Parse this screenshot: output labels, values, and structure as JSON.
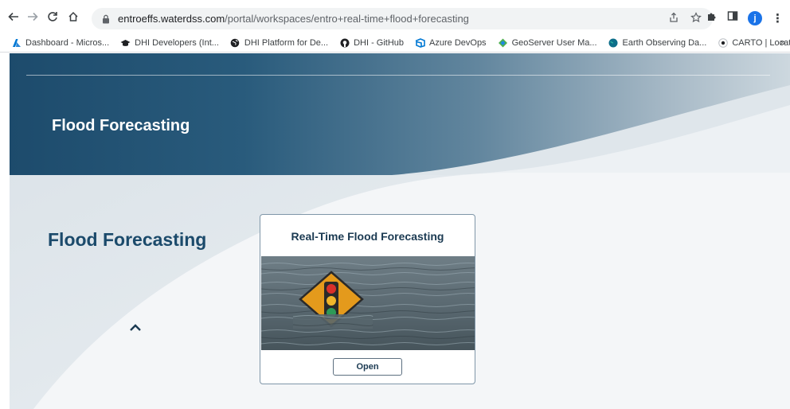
{
  "browser": {
    "url_host": "entroeffs.waterdss.com",
    "url_path": "/portal/workspaces/entro+real-time+flood+forecasting",
    "profile_initial": "j"
  },
  "bookmarks": {
    "items": [
      {
        "label": "Dashboard - Micros...",
        "icon": "azure-devops-dashboard-icon"
      },
      {
        "label": "DHI Developers (Int...",
        "icon": "graduation-cap-icon"
      },
      {
        "label": "DHI Platform for De...",
        "icon": "globe-icon"
      },
      {
        "label": "DHI - GitHub",
        "icon": "github-icon"
      },
      {
        "label": "Azure DevOps",
        "icon": "azure-devops-icon"
      },
      {
        "label": "GeoServer User Ma...",
        "icon": "geoserver-icon"
      },
      {
        "label": "Earth Observing Da...",
        "icon": "earth-icon"
      },
      {
        "label": "CARTO | Location In...",
        "icon": "carto-icon"
      }
    ],
    "more": "»"
  },
  "hero": {
    "title": "Flood Forecasting"
  },
  "section": {
    "title": "Flood Forecasting"
  },
  "card": {
    "title": "Real-Time Flood Forecasting",
    "image": "flooded-traffic-sign-image",
    "button_label": "Open"
  },
  "colors": {
    "hero_dark": "#1e4e6e",
    "title_navy": "#1b4a6b",
    "card_border": "#7f96a8"
  }
}
